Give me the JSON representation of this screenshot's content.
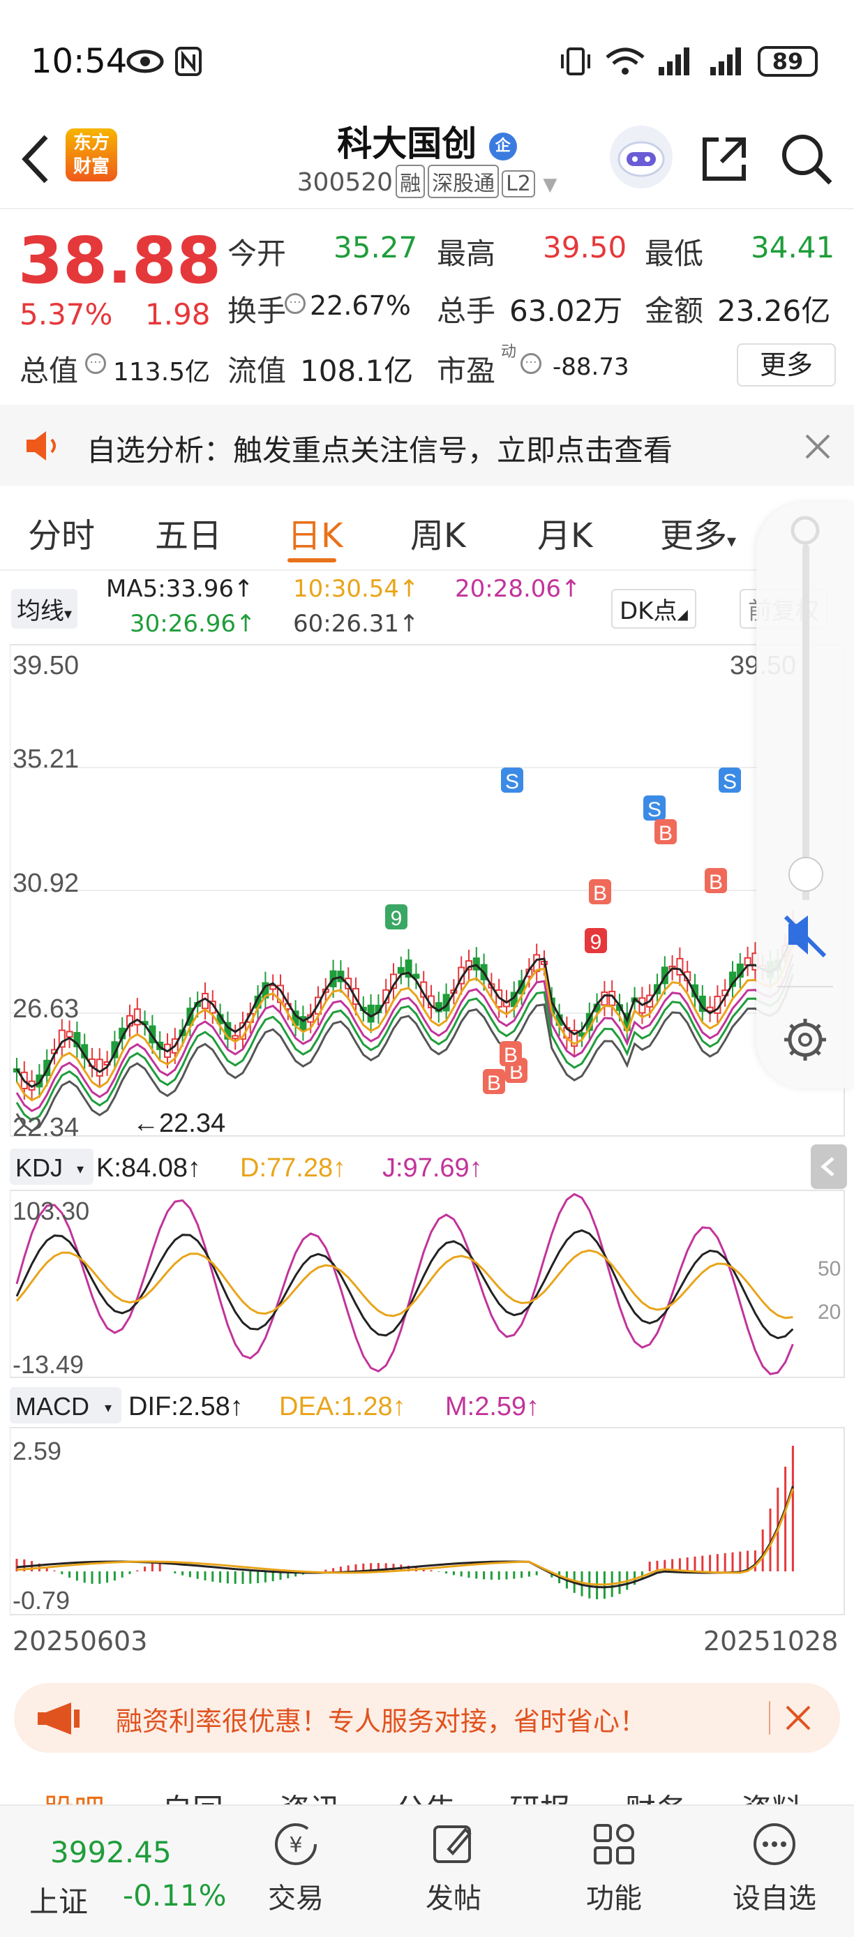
{
  "status_bar": {
    "time": "10:54",
    "battery": "89"
  },
  "header": {
    "stock_name": "科大国创",
    "corp_badge": "企",
    "logo_text_1": "东方",
    "logo_text_2": "财富",
    "stock_code": "300520",
    "tags": [
      "融",
      "深股通",
      "L2"
    ]
  },
  "quote": {
    "price": "38.88",
    "change_pct": "5.37%",
    "change": "1.98",
    "open_label": "今开",
    "open": "35.27",
    "high_label": "最高",
    "high": "39.50",
    "low_label": "最低",
    "low": "34.41",
    "turnover_label": "换手",
    "turnover": "22.67%",
    "volume_label": "总手",
    "volume": "63.02万",
    "amount_label": "金额",
    "amount": "23.26亿",
    "mktcap_label": "总值",
    "mktcap": "113.5亿",
    "float_label": "流值",
    "float": "108.1亿",
    "pe_label": "市盈",
    "pe_sup": "动",
    "pe": "-88.73",
    "more_button": "更多"
  },
  "alert_banner": {
    "text": "自选分析：触发重点关注信号，立即点击查看"
  },
  "period_tabs": [
    "分时",
    "五日",
    "日K",
    "周K",
    "月K",
    "更多"
  ],
  "active_period": "日K",
  "ma": {
    "selector": "均线",
    "ma5": "MA5:33.96↑",
    "ma10": "10:30.54↑",
    "ma20": "20:28.06↑",
    "ma30": "30:26.96↑",
    "ma60": "60:26.31↑",
    "dk_button": "DK点",
    "adjust_button": "前复权"
  },
  "kline": {
    "y_labels": [
      "39.50",
      "35.21",
      "30.92",
      "26.63",
      "22.34"
    ],
    "max_label": "39.50",
    "min_label": "←22.34",
    "colors": {
      "up": "#e5383b",
      "down": "#1f9d3a",
      "ma5": "#222222",
      "ma10": "#e9a41a",
      "ma20": "#c2339a",
      "ma30": "#1f9d3a",
      "ma60": "#555555"
    }
  },
  "kdj": {
    "selector": "KDJ",
    "k": "K:84.08↑",
    "d": "D:77.28↑",
    "j": "J:97.69↑",
    "y_top": "103.30",
    "y_bottom": "-13.49",
    "y_mid_1": "50",
    "y_mid_2": "20"
  },
  "macd": {
    "selector": "MACD",
    "dif": "DIF:2.58↑",
    "dea": "DEA:1.28↑",
    "m": "M:2.59↑",
    "y_top": "2.59",
    "y_bottom": "-0.79"
  },
  "dates": {
    "start": "20250603",
    "end": "20251028"
  },
  "promo": {
    "text": "融资利率很优惠！专人服务对接，省时省心！"
  },
  "section_tabs_peek": [
    "股吧",
    "自回",
    "资讯",
    "公告",
    "研报",
    "财务",
    "资料"
  ],
  "bottom_nav": {
    "index_value": "3992.45",
    "index_name": "上证",
    "index_change": "-0.11%",
    "items": [
      "交易",
      "发帖",
      "功能",
      "设自选"
    ]
  }
}
